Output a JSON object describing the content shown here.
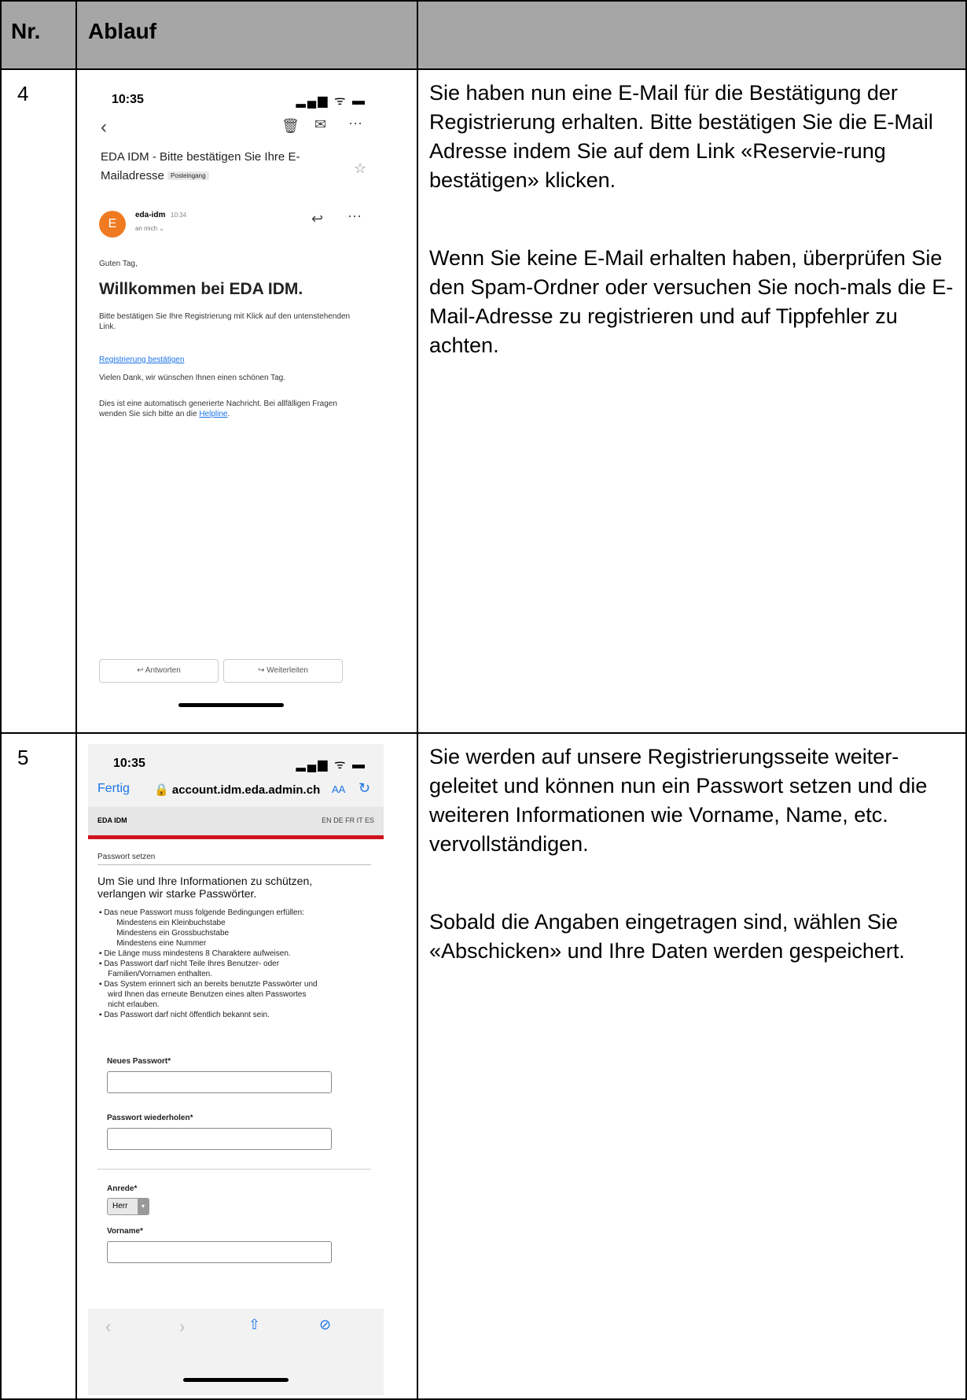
{
  "table": {
    "col_nr": "Nr.",
    "col_ablauf": "Ablauf"
  },
  "row4": {
    "number": "4",
    "description": [
      "Sie haben nun eine E-Mail für die Bestätigung der Registrierung erhalten. Bitte bestätigen Sie die E-Mail Adresse indem Sie auf dem Link «Reservie-rung bestätigen» klicken.",
      "Wenn Sie keine E-Mail erhalten haben, überprüfen Sie den Spam-Ordner oder versuchen Sie noch-mals die E-Mail-Adresse zu registrieren und auf Tippfehler zu achten."
    ],
    "phone": {
      "time": "10:35",
      "status_icons": "▂▄▆ ᯤ ▬",
      "subject": "EDA IDM - Bitte bestätigen Sie Ihre E-Mailadresse",
      "label": "Posteingang",
      "sender_initial": "E",
      "sender": "eda-idm",
      "sent_time": "10:34",
      "recipient": "an mich ⌄",
      "greeting": "Guten Tag,",
      "heading": "Willkommen bei EDA IDM.",
      "body1": "Bitte bestätigen Sie Ihre Registrierung mit Klick auf den untenstehenden Link.",
      "link": "Registrierung bestätigen",
      "body2": "Vielen Dank, wir wünschen Ihnen einen schönen Tag.",
      "body3_prefix": "Dies ist eine automatisch generierte Nachricht. Bei allfälligen Fragen wenden Sie sich bitte an die ",
      "helpline": "Helpline",
      "body3_suffix": ".",
      "reply_btn": "Antworten",
      "forward_btn": "Weiterleiten"
    }
  },
  "row5": {
    "number": "5",
    "description": [
      "Sie werden auf unsere Registrierungsseite weiter-geleitet und können nun ein Passwort setzen und die weiteren Informationen wie Vorname, Name, etc. vervollständigen.",
      "Sobald die Angaben eingetragen sind, wählen Sie «Abschicken» und Ihre Daten werden gespeichert."
    ],
    "phone": {
      "time": "10:35",
      "status_icons": "▂▄▆ ᯤ ▬",
      "done": "Fertig",
      "url": "account.idm.eda.admin.ch",
      "text_size": "AA",
      "site_name": "EDA IDM",
      "languages": "EN  DE  FR  IT  ES",
      "section": "Passwort setzen",
      "headline": "Um Sie und Ihre Informationen zu schützen, verlangen wir starke Passwörter.",
      "rules": [
        "▪  Das neue Passwort muss folgende Bedingungen erfüllen:",
        "        Mindestens ein Kleinbuchstabe",
        "        Mindestens ein Grossbuchstabe",
        "        Mindestens eine Nummer",
        "▪  Die Länge muss mindestens 8 Charaktere aufweisen.",
        "▪  Das Passwort darf nicht Teile Ihres Benutzer- oder",
        "    Familien/Vornamen enthalten.",
        "▪  Das System erinnert sich an bereits benutzte Passwörter und",
        "    wird Ihnen das erneute Benutzen eines alten Passwortes",
        "    nicht erlauben.",
        "▪  Das Passwort darf nicht öffentlich bekannt sein."
      ],
      "new_pw_label": "Neues Passwort*",
      "repeat_pw_label": "Passwort wiederholen*",
      "salutation_label": "Anrede*",
      "salutation_value": "Herr",
      "firstname_label": "Vorname*"
    }
  }
}
